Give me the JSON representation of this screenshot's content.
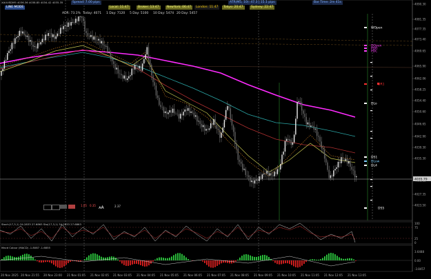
{
  "symbol_line": "XAUUSDM5 4036.36 4038.85 4034.42 4035.35",
  "mode_label": "LINE MODE",
  "info": {
    "spread": "Spread: 7.00 pips",
    "local": "Local: 11:47",
    "broker": "Broker: 13:47",
    "newyork": "NewYork: 06:47",
    "london": "London: 11:47",
    "tokyo": "Tokyo: 20:47",
    "sydney": "Sydney: 22:47",
    "atr": "ATR(M5, 10): 47.3 | 15.1 pips",
    "bar_time": "Bar Time: 2m 41s"
  },
  "adr": {
    "adr": "ADR: 73.1%",
    "today": "Today: 4071",
    "day1": "1 Day: 7120",
    "day5": "5 Day: 5100",
    "day10": "10 Day: 5474",
    "day20": "20 Day: 5457"
  },
  "level_labels": [
    "WOpen",
    "DOpen",
    "PDH",
    "PDC",
    "DR1",
    "DLo",
    "DS1",
    "DLow",
    "DL4",
    "DS5"
  ],
  "y_ticks": [
    "4090.30",
    "4081.35",
    "4077.35",
    "4073.40",
    "4069.65",
    "4065.90",
    "4062.06",
    "4058.25",
    "4054.40",
    "4050.60",
    "4046.65",
    "4042.90",
    "4039.30",
    "4035.30",
    "4031.15",
    "4027.35",
    "4023.50"
  ],
  "current_price": "4035.79",
  "x_ticks": [
    "20 Nov 2025",
    "20 Nov 21:55",
    "20 Nov 23:00",
    "21 Nov 01:05",
    "21 Nov 02:05",
    "21 Nov 03:05",
    "21 Nov 04:05",
    "21 Nov 05:05",
    "21 Nov 06:05",
    "21 Nov 07:05",
    "21 Nov 08:05",
    "21 Nov 09:05",
    "21 Nov 10:05",
    "21 Nov 11:05",
    "21 Nov 12:05",
    "21 Nov 13:05"
  ],
  "stoch_label": "Stoch(17,3,1) 34.2833 27.6863  Sto(17,3,1) 34.2833 27.6863",
  "stoch_ticks": [
    "100",
    "75",
    "25",
    "0"
  ],
  "macd_label": "Macd Colour (MACD) -1.8087 -1.6855",
  "macd_ticks": [
    "3.6488",
    "0.00",
    "-3.8457"
  ],
  "rate_boxes": [
    "1.05",
    "0.35",
    "2.37"
  ],
  "colors": {
    "ma_magenta": "#ff2bff",
    "ma_cyan": "#2aa6a6",
    "ma_red": "#b03030",
    "ma_yellow": "#c8c850",
    "bull": "#2ecc40",
    "bear": "#e02020",
    "candle": "#d0d0d0"
  }
}
